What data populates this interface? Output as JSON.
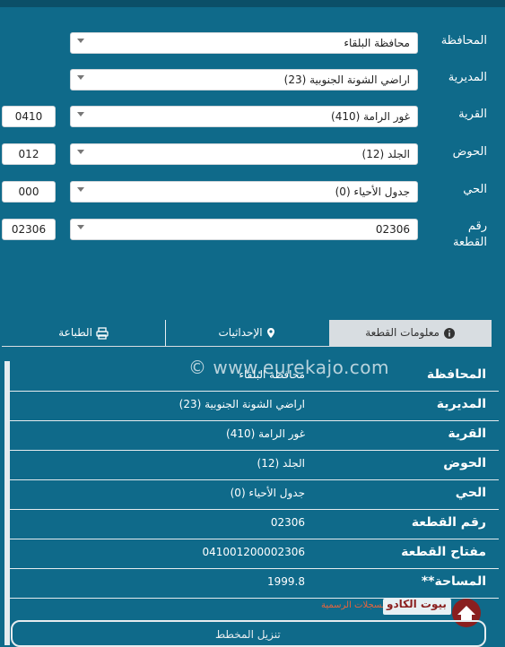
{
  "form": {
    "rows": [
      {
        "label": "المحافظة",
        "value": "محافظة البلقاء",
        "code": ""
      },
      {
        "label": "المديرية",
        "value": "اراضي الشونة الجنوبية (23)",
        "code": ""
      },
      {
        "label": "القرية",
        "value": "غور الرامة (410)",
        "code": "0410"
      },
      {
        "label": "الحوض",
        "value": "الجلد (12)",
        "code": "012"
      },
      {
        "label": "الحي",
        "value": "جدول الأحياء (0)",
        "code": "000"
      },
      {
        "label": "رقم القطعة",
        "value": "02306",
        "code": "02306"
      }
    ]
  },
  "tabs": {
    "info": "معلومات القطعة",
    "coords": "الإحداثيات",
    "print": "الطباعة"
  },
  "details": [
    {
      "key": "المحافظة",
      "value": "محافظة البلقاء"
    },
    {
      "key": "المديرية",
      "value": "اراضي الشونة الجنوبية (23)"
    },
    {
      "key": "القرية",
      "value": "غور الرامة (410)"
    },
    {
      "key": "الحوض",
      "value": "الجلد (12)"
    },
    {
      "key": "الحي",
      "value": "جدول الأحياء (0)"
    },
    {
      "key": "رقم القطعة",
      "value": "02306"
    },
    {
      "key": "مفتاح القطعة",
      "value": "041001200002306"
    },
    {
      "key": "**المساحة",
      "value": "1999.8"
    }
  ],
  "watermark": "© www.eurekajo.com",
  "note": "بحسب السجلات الرسمية",
  "logo_text": "بيوت الكادو",
  "bottom_button": "تنزيل المخطط"
}
